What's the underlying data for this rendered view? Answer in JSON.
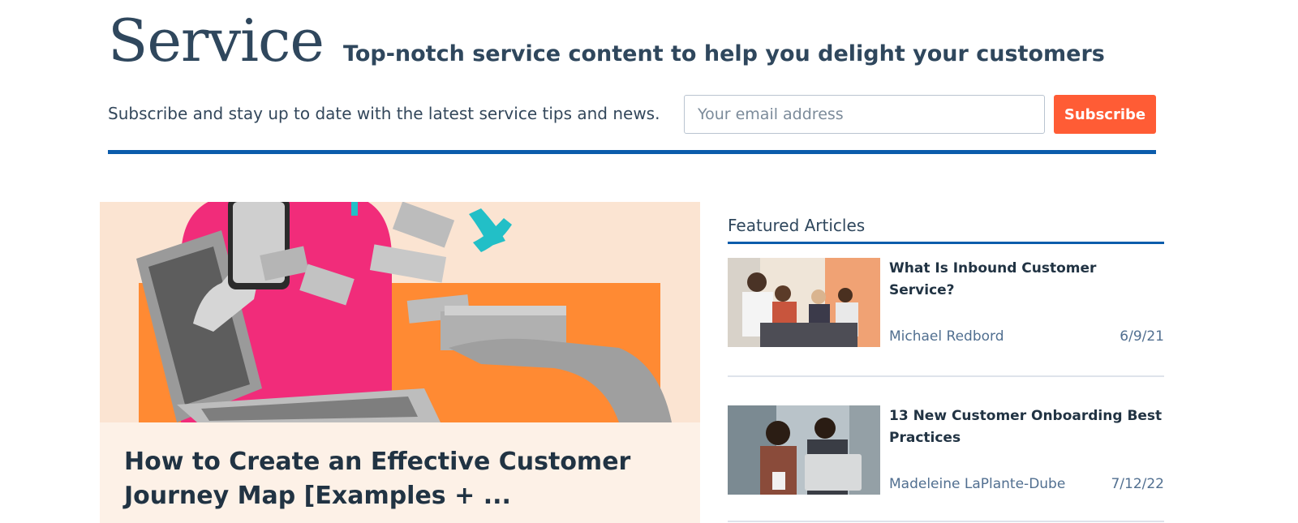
{
  "header": {
    "brand": "Service",
    "tagline": "Top-notch service content to help you delight your customers"
  },
  "subscribe": {
    "text": "Subscribe and stay up to date with the latest service tips and news.",
    "email_placeholder": "Your email address",
    "button_label": "Subscribe"
  },
  "hero": {
    "title": "How to Create an Effective Customer Journey Map [Examples + ..."
  },
  "featured": {
    "heading": "Featured Articles",
    "articles": [
      {
        "title": "What Is Inbound Customer Service?",
        "author": "Michael Redbord",
        "date": "6/9/21"
      },
      {
        "title": "13 New Customer Onboarding Best Practices",
        "author": "Madeleine LaPlante-Dube",
        "date": "7/12/22"
      }
    ]
  },
  "colors": {
    "accent_blue": "#0b5cab",
    "subscribe_orange": "#ff5c35",
    "text_dark": "#213343"
  }
}
